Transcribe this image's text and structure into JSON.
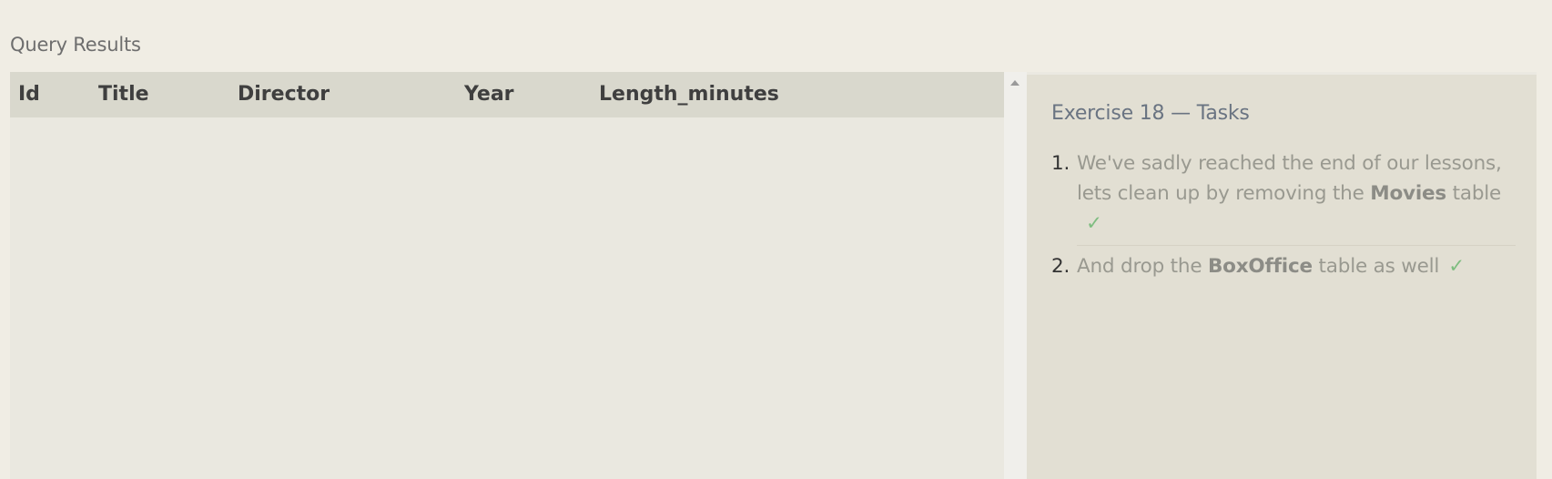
{
  "results": {
    "heading": "Query Results",
    "columns": [
      "Id",
      "Title",
      "Director",
      "Year",
      "Length_minutes"
    ],
    "rows": []
  },
  "tasks": {
    "title": "Exercise 18 — Tasks",
    "items": [
      {
        "number": "1.",
        "text_before": "We've sadly reached the end of our lessons, lets clean up by removing the ",
        "bold": "Movies",
        "text_after": " table",
        "check": "✓"
      },
      {
        "number": "2.",
        "text_before": "And drop the ",
        "bold": "BoxOffice",
        "text_after": " table as well",
        "check": "✓"
      }
    ]
  },
  "colors": {
    "background": "#f0ede4",
    "table_header": "#d9d8cd",
    "tasks_panel": "#e2dfd3",
    "check": "#7ebd80"
  }
}
